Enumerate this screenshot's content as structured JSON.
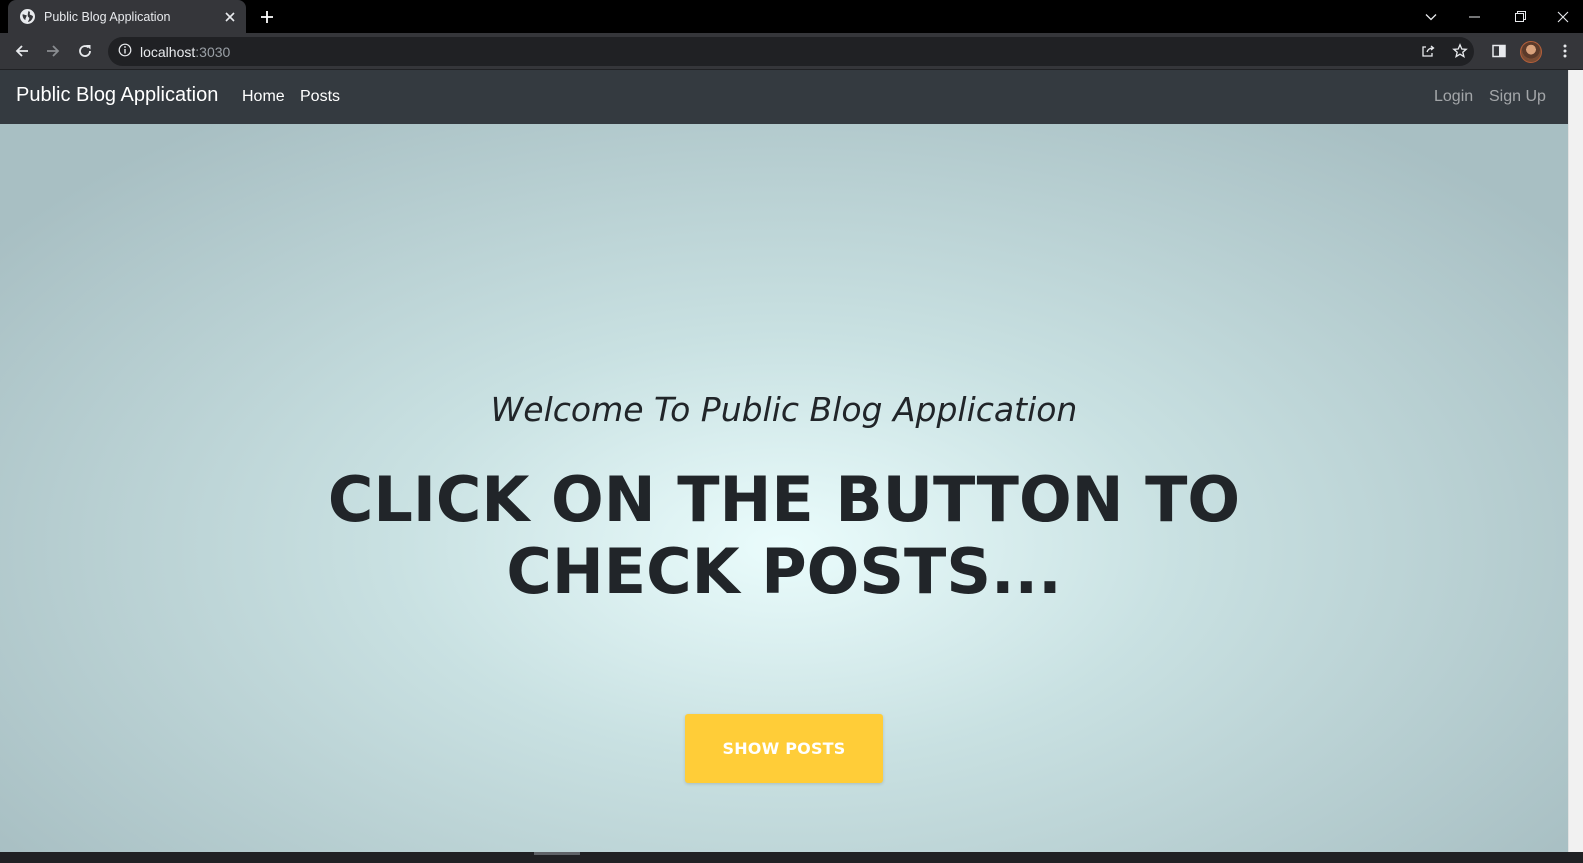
{
  "browser": {
    "tab_title": "Public Blog Application",
    "url_host": "localhost",
    "url_port": ":3030"
  },
  "navbar": {
    "brand": "Public Blog Application",
    "links": [
      "Home",
      "Posts"
    ],
    "auth_links": [
      "Login",
      "Sign Up"
    ]
  },
  "hero": {
    "welcome": "Welcome To Public Blog Application",
    "headline_line1": "CLICK ON THE BUTTON TO",
    "headline_line2": "CHECK POSTS...",
    "button_label": "SHOW POSTS"
  },
  "colors": {
    "navbar_bg": "#343a40",
    "button_bg": "#ffcd38",
    "text_dark": "#212529"
  },
  "icons": [
    "globe-icon",
    "close-icon",
    "plus-icon",
    "chevron-down-icon",
    "minimize-icon",
    "restore-icon",
    "window-close-icon",
    "back-arrow-icon",
    "forward-arrow-icon",
    "reload-icon",
    "info-icon",
    "share-icon",
    "star-icon",
    "side-panel-icon",
    "more-vert-icon"
  ]
}
